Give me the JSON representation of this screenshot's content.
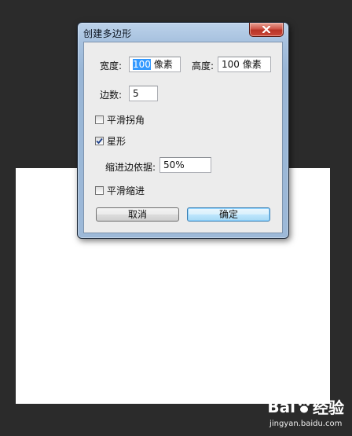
{
  "dialog": {
    "title": "创建多边形",
    "width_label": "宽度:",
    "width_value_selected": "100",
    "width_value_rest": " 像素",
    "height_label": "高度:",
    "height_value": "100 像素",
    "sides_label": "边数:",
    "sides_value": "5",
    "smooth_corners_label": "平滑拐角",
    "smooth_corners_checked": false,
    "star_label": "星形",
    "star_checked": true,
    "indent_label": "缩进边依据:",
    "indent_value": "50%",
    "smooth_indents_label": "平滑缩进",
    "smooth_indents_checked": false,
    "cancel_label": "取消",
    "ok_label": "确定"
  },
  "watermark": {
    "brand_part1": "Bai",
    "brand_part2": "经验",
    "url": "jingyan.baidu.com"
  },
  "icons": {
    "close": "close-icon",
    "checkmark": "checkmark-icon",
    "paw": "paw-icon"
  },
  "colors": {
    "background": "#2b2b2b",
    "canvas": "#ffffff",
    "selection": "#3399ff",
    "close_button": "#c9483a"
  }
}
